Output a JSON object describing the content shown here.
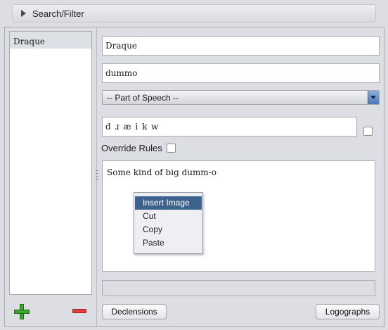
{
  "search_bar": {
    "label": "Search/Filter"
  },
  "word_list": {
    "items": [
      "Draque"
    ]
  },
  "fields": {
    "conword": "Draque",
    "local_word": "dummo",
    "part_of_speech": "-- Part of Speech --",
    "pronunciation": "d ɹ æ i k w",
    "override_rules_label": "Override Rules",
    "definition": "Some kind of big dumm-o"
  },
  "context_menu": {
    "items": [
      "Insert Image",
      "Cut",
      "Copy",
      "Paste"
    ],
    "highlighted": "Insert Image"
  },
  "buttons": {
    "declensions": "Declensions",
    "logographs": "Logographs"
  },
  "icons": {
    "add": "plus-icon",
    "delete": "minus-icon"
  },
  "colors": {
    "add": "#3ea62c",
    "delete": "#e04040",
    "menu_highlight": "#3d638d",
    "dropdown_arrow": "#4a77b6"
  }
}
